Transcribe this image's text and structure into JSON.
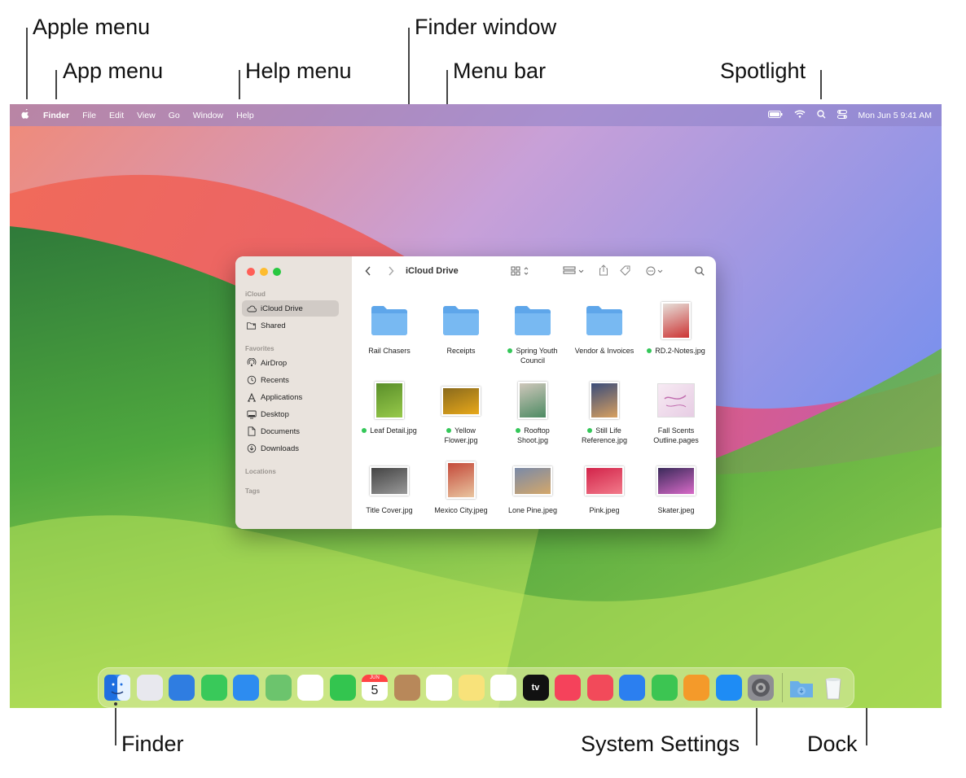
{
  "callouts": {
    "apple_menu": "Apple menu",
    "app_menu": "App menu",
    "help_menu": "Help menu",
    "finder_window": "Finder window",
    "menu_bar": "Menu bar",
    "spotlight": "Spotlight",
    "finder": "Finder",
    "system_settings": "System Settings",
    "dock": "Dock"
  },
  "menubar": {
    "apple_icon": "apple-icon",
    "items": [
      "Finder",
      "File",
      "Edit",
      "View",
      "Go",
      "Window",
      "Help"
    ],
    "datetime": "Mon Jun 5  9:41 AM"
  },
  "finder_window": {
    "title": "iCloud Drive",
    "sidebar": {
      "sections": {
        "icloud": "iCloud",
        "favorites": "Favorites",
        "locations": "Locations",
        "tags": "Tags"
      },
      "icloud_items": [
        {
          "label": "iCloud Drive",
          "icon": "cloud-icon"
        },
        {
          "label": "Shared",
          "icon": "shared-folder-icon"
        }
      ],
      "favorite_items": [
        {
          "label": "AirDrop",
          "icon": "airdrop-icon"
        },
        {
          "label": "Recents",
          "icon": "clock-icon"
        },
        {
          "label": "Applications",
          "icon": "applications-icon"
        },
        {
          "label": "Desktop",
          "icon": "desktop-icon"
        },
        {
          "label": "Documents",
          "icon": "document-icon"
        },
        {
          "label": "Downloads",
          "icon": "download-icon"
        }
      ]
    },
    "files": [
      {
        "name": "Rail Chasers",
        "kind": "folder",
        "tag": false
      },
      {
        "name": "Receipts",
        "kind": "folder",
        "tag": false
      },
      {
        "name": "Spring Youth",
        "name2": "Council",
        "kind": "folder",
        "tag": true
      },
      {
        "name": "Vendor & Invoices",
        "kind": "folder",
        "tag": false
      },
      {
        "name": "RD.2-Notes.jpg",
        "kind": "image",
        "tag": true
      },
      {
        "name": "Leaf Detail.jpg",
        "kind": "image",
        "tag": true
      },
      {
        "name": "Yellow",
        "name2": "Flower.jpg",
        "kind": "image",
        "tag": true
      },
      {
        "name": "Rooftop",
        "name2": "Shoot.jpg",
        "kind": "image",
        "tag": true
      },
      {
        "name": "Still Life",
        "name2": "Reference.jpg",
        "kind": "image",
        "tag": true
      },
      {
        "name": "Fall Scents",
        "name2": "Outline.pages",
        "kind": "pages",
        "tag": false
      },
      {
        "name": "Title Cover.jpg",
        "kind": "image",
        "tag": false
      },
      {
        "name": "Mexico City.jpeg",
        "kind": "image",
        "tag": false
      },
      {
        "name": "Lone Pine.jpeg",
        "kind": "image",
        "tag": false
      },
      {
        "name": "Pink.jpeg",
        "kind": "image",
        "tag": false
      },
      {
        "name": "Skater.jpeg",
        "kind": "image",
        "tag": false
      }
    ]
  },
  "dock": {
    "calendar_month": "JUN",
    "calendar_day": "5",
    "tv_label": "tv",
    "apps": [
      {
        "name": "finder-icon",
        "color": "#3b8ff0"
      },
      {
        "name": "launchpad-icon",
        "color": "#e8e8ee"
      },
      {
        "name": "safari-icon",
        "color": "#2f7de1"
      },
      {
        "name": "messages-icon",
        "color": "#39c95a"
      },
      {
        "name": "mail-icon",
        "color": "#2d8cf0"
      },
      {
        "name": "maps-icon",
        "color": "#6cc46d"
      },
      {
        "name": "photos-icon",
        "color": "#ffffff"
      },
      {
        "name": "facetime-icon",
        "color": "#33c54f"
      },
      {
        "name": "calendar-icon",
        "color": "#ffffff"
      },
      {
        "name": "contacts-icon",
        "color": "#b8885a"
      },
      {
        "name": "reminders-icon",
        "color": "#ffffff"
      },
      {
        "name": "notes-icon",
        "color": "#f8e27a"
      },
      {
        "name": "freeform-icon",
        "color": "#ffffff"
      },
      {
        "name": "apple-tv-icon",
        "color": "#111111"
      },
      {
        "name": "music-icon",
        "color": "#f5425b"
      },
      {
        "name": "news-icon",
        "color": "#f24a5a"
      },
      {
        "name": "keynote-icon",
        "color": "#2b7ff0"
      },
      {
        "name": "numbers-icon",
        "color": "#3cc552"
      },
      {
        "name": "pages-icon",
        "color": "#f49a2a"
      },
      {
        "name": "app-store-icon",
        "color": "#1e8cf5"
      },
      {
        "name": "system-settings-icon",
        "color": "#8e8e93"
      },
      {
        "name": "downloads-stack-icon",
        "color": "#7fb6ea"
      },
      {
        "name": "trash-icon",
        "color": "#e8eef0"
      }
    ]
  }
}
